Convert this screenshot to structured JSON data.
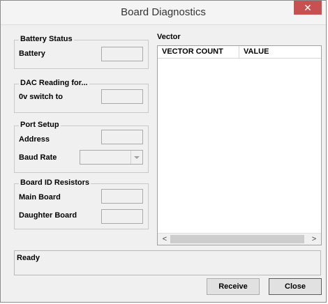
{
  "window": {
    "title": "Board Diagnostics",
    "close_symbol": "✕"
  },
  "battery": {
    "legend": "Battery Status",
    "label": "Battery",
    "value": ""
  },
  "dac": {
    "legend": "DAC Reading for...",
    "label": "0v switch to",
    "value": ""
  },
  "port": {
    "legend": "Port Setup",
    "address_label": "Address",
    "address_value": "",
    "baud_label": "Baud Rate",
    "baud_value": ""
  },
  "board_id": {
    "legend": "Board ID Resistors",
    "main_label": "Main Board",
    "main_value": "",
    "daughter_label": "Daughter Board",
    "daughter_value": ""
  },
  "vector": {
    "label": "Vector",
    "columns": [
      "VECTOR COUNT",
      "VALUE"
    ],
    "scroll_left": "<",
    "scroll_right": ">"
  },
  "status": {
    "text": "Ready"
  },
  "buttons": {
    "receive": "Receive",
    "close": "Close"
  }
}
